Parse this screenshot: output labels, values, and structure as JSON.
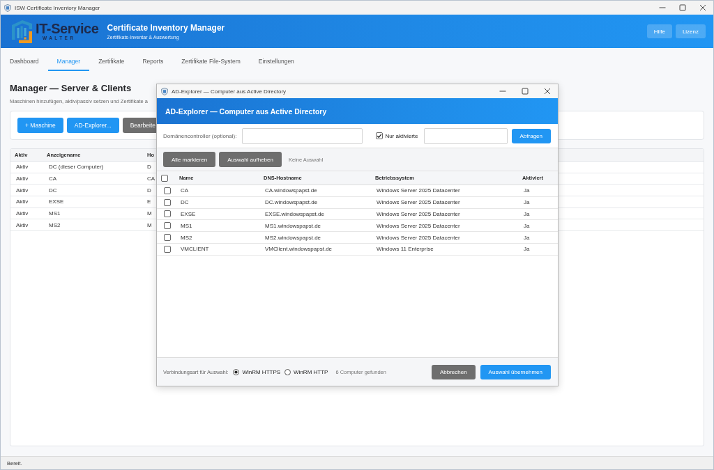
{
  "window": {
    "title": "ISW Certificate Inventory Manager"
  },
  "header": {
    "logo": {
      "name": "IT-Service",
      "tagline": "WALTER"
    },
    "title": "Certificate Inventory Manager",
    "subtitle": "Zertifikats-Inventar & Auswertung",
    "buttons": [
      "Hilfe",
      "Lizenz"
    ]
  },
  "tabs": [
    {
      "label": "Dashboard",
      "selected": false
    },
    {
      "label": "Manager",
      "selected": true
    },
    {
      "label": "Zertifikate",
      "selected": false
    },
    {
      "label": "Reports",
      "selected": false
    },
    {
      "label": "Zertifikate File-System",
      "selected": false
    },
    {
      "label": "Einstellungen",
      "selected": false
    }
  ],
  "page": {
    "title": "Manager — Server & Clients",
    "description": "Maschinen hinzufügen, aktiv/passiv setzen und Zertifikate a",
    "toolbar": [
      {
        "label": "+ Maschine",
        "kind": "primary"
      },
      {
        "label": "AD-Explorer...",
        "kind": "primary"
      },
      {
        "label": "Bearbeite",
        "kind": "secondary"
      }
    ],
    "table": {
      "columns": [
        "Aktiv",
        "Anzeigename",
        "Ho"
      ],
      "rows": [
        [
          "Aktiv",
          "DC (dieser Computer)",
          "D"
        ],
        [
          "Aktiv",
          "CA",
          "CA"
        ],
        [
          "Aktiv",
          "DC",
          "D"
        ],
        [
          "Aktiv",
          "EXSE",
          "E"
        ],
        [
          "Aktiv",
          "MS1",
          "M"
        ],
        [
          "Aktiv",
          "MS2",
          "M"
        ]
      ]
    }
  },
  "dialog": {
    "title": "AD-Explorer — Computer aus Active Directory",
    "heading": "AD-Explorer — Computer aus Active Directory",
    "domain_controller": {
      "label": "Domänencontroller (optional):"
    },
    "only_enabled": {
      "label": "Nur aktivierte",
      "checked": true
    },
    "query_button": "Abfragen",
    "selection_buttons": [
      "Alle markieren",
      "Auswahl aufheben"
    ],
    "selection_status": "Keine Auswahl",
    "table": {
      "select_all": {
        "checked": false
      },
      "columns": [
        "Name",
        "DNS-Hostname",
        "Betriebssystem",
        "Aktiviert"
      ],
      "rows": [
        {
          "checked": false,
          "cells": [
            "CA",
            "CA.windowspapst.de",
            "Windows Server 2025 Datacenter",
            "Ja"
          ]
        },
        {
          "checked": false,
          "cells": [
            "DC",
            "DC.windowspapst.de",
            "Windows Server 2025 Datacenter",
            "Ja"
          ]
        },
        {
          "checked": false,
          "cells": [
            "EXSE",
            "EXSE.windowspapst.de",
            "Windows Server 2025 Datacenter",
            "Ja"
          ]
        },
        {
          "checked": false,
          "cells": [
            "MS1",
            "MS1.windowspapst.de",
            "Windows Server 2025 Datacenter",
            "Ja"
          ]
        },
        {
          "checked": false,
          "cells": [
            "MS2",
            "MS2.windowspapst.de",
            "Windows Server 2025 Datacenter",
            "Ja"
          ]
        },
        {
          "checked": false,
          "cells": [
            "VMCLIENT",
            "VMClient.windowspapst.de",
            "Windows 11 Enterprise",
            "Ja"
          ]
        }
      ]
    },
    "footer": {
      "connection_label": "Verbindungsart für Auswahl:",
      "connection_options": [
        {
          "label": "WinRM HTTPS",
          "selected": true
        },
        {
          "label": "WinRM HTTP",
          "selected": false
        }
      ],
      "count": "6 Computer gefunden",
      "buttons": [
        {
          "label": "Abbrechen",
          "kind": "secondary"
        },
        {
          "label": "Auswahl übernehmen",
          "kind": "primary"
        }
      ]
    }
  },
  "status_bar": {
    "text": "Bereit."
  }
}
